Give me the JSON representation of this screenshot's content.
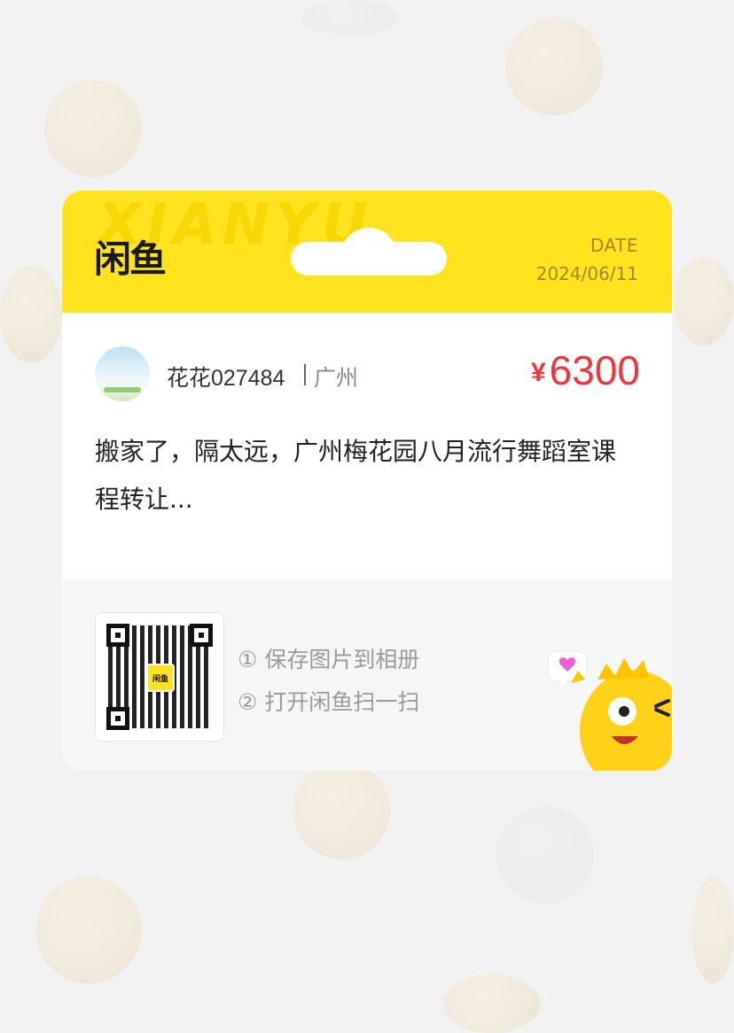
{
  "header": {
    "watermark": "XIANYU",
    "logo_text": "闲鱼",
    "date_label": "DATE",
    "date_value": "2024/06/11"
  },
  "seller": {
    "name": "花花027484",
    "city": "广州"
  },
  "price": {
    "symbol": "¥",
    "value": "6300"
  },
  "description": "搬家了，隔太远，广州梅花园八月流行舞蹈室课程转让...",
  "footer": {
    "qr_logo": "闲鱼",
    "steps": [
      "① 保存图片到相册",
      "② 打开闲鱼扫一扫"
    ]
  },
  "colors": {
    "brand_yellow": "#ffe31f",
    "price_red": "#f0353d",
    "background": "#f1f1f1"
  }
}
